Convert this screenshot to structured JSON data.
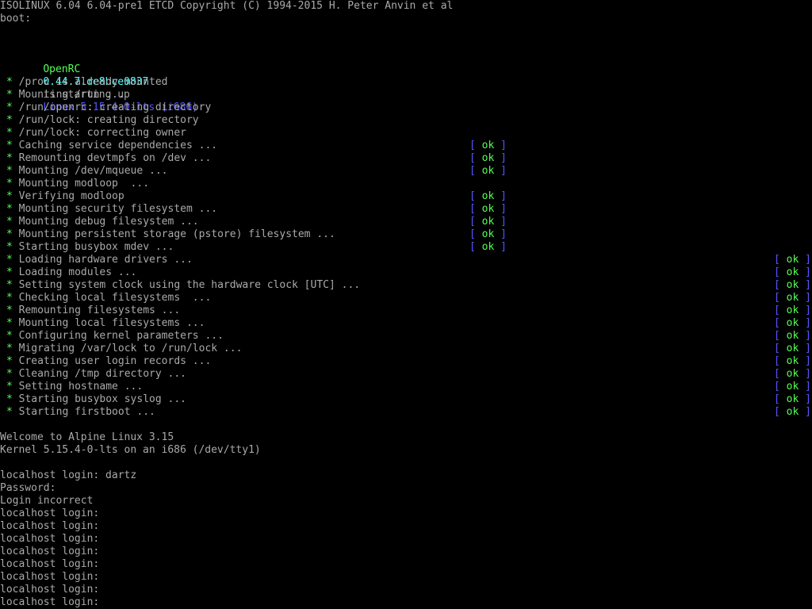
{
  "header": {
    "isolinux": "ISOLINUX 6.04 6.04-pre1 ETCD Copyright (C) 1994-2015 H. Peter Anvin et al",
    "boot_prompt": "boot:"
  },
  "openrc_banner": {
    "name": "OpenRC",
    "version": "0.44.7.de8bce0837",
    "middle": "is starting up",
    "kernel": "Linux 5.15.4-0-lts (i686)"
  },
  "colors": {
    "background": "#000000",
    "text": "#aaaaaa",
    "ok_green": "#55ff55",
    "bracket_blue": "#5555ff",
    "version_cyan": "#55ffff"
  },
  "service_lines": [
    {
      "bullet": "*",
      "text": "/proc is already mounted",
      "status": ""
    },
    {
      "bullet": "*",
      "text": "Mounting /run ...",
      "status": ""
    },
    {
      "bullet": "*",
      "text": "/run/openrc: creating directory",
      "status": ""
    },
    {
      "bullet": "*",
      "text": "/run/lock: creating directory",
      "status": ""
    },
    {
      "bullet": "*",
      "text": "/run/lock: correcting owner",
      "status": ""
    },
    {
      "bullet": "*",
      "text": "Caching service dependencies ...",
      "status": "ok"
    },
    {
      "bullet": "*",
      "text": "Remounting devtmpfs on /dev ...",
      "status": "ok"
    },
    {
      "bullet": "*",
      "text": "Mounting /dev/mqueue ...",
      "status": "ok"
    },
    {
      "bullet": "*",
      "text": "Mounting modloop  ...",
      "status": ""
    },
    {
      "bullet": "*",
      "text": "Verifying modloop",
      "status": "ok"
    },
    {
      "bullet": "*",
      "text": "Mounting security filesystem ...",
      "status": "ok"
    },
    {
      "bullet": "*",
      "text": "Mounting debug filesystem ...",
      "status": "ok"
    },
    {
      "bullet": "*",
      "text": "Mounting persistent storage (pstore) filesystem ...",
      "status": "ok"
    },
    {
      "bullet": "*",
      "text": "Starting busybox mdev ...",
      "status": "ok"
    },
    {
      "bullet": "*",
      "text": "Loading hardware drivers ...",
      "status": "ok"
    },
    {
      "bullet": "*",
      "text": "Loading modules ...",
      "status": "ok"
    },
    {
      "bullet": "*",
      "text": "Setting system clock using the hardware clock [UTC] ...",
      "status": "ok"
    },
    {
      "bullet": "*",
      "text": "Checking local filesystems  ...",
      "status": "ok"
    },
    {
      "bullet": "*",
      "text": "Remounting filesystems ...",
      "status": "ok"
    },
    {
      "bullet": "*",
      "text": "Mounting local filesystems ...",
      "status": "ok"
    },
    {
      "bullet": "*",
      "text": "Configuring kernel parameters ...",
      "status": "ok"
    },
    {
      "bullet": "*",
      "text": "Migrating /var/lock to /run/lock ...",
      "status": "ok"
    },
    {
      "bullet": "*",
      "text": "Creating user login records ...",
      "status": "ok"
    },
    {
      "bullet": "*",
      "text": "Cleaning /tmp directory ...",
      "status": "ok"
    },
    {
      "bullet": "*",
      "text": "Setting hostname ...",
      "status": "ok"
    },
    {
      "bullet": "*",
      "text": "Starting busybox syslog ...",
      "status": "ok"
    },
    {
      "bullet": "*",
      "text": "Starting firstboot ...",
      "status": "ok"
    }
  ],
  "status_markers": {
    "open": "[",
    "close": "]"
  },
  "welcome": {
    "line1": "Welcome to Alpine Linux 3.15",
    "line2": "Kernel 5.15.4-0-lts on an i686 (/dev/tty1)"
  },
  "login_session": [
    "localhost login: dartz",
    "Password:",
    "Login incorrect",
    "localhost login:",
    "localhost login:",
    "localhost login:",
    "localhost login:",
    "localhost login:",
    "localhost login:",
    "localhost login:",
    "localhost login:"
  ]
}
